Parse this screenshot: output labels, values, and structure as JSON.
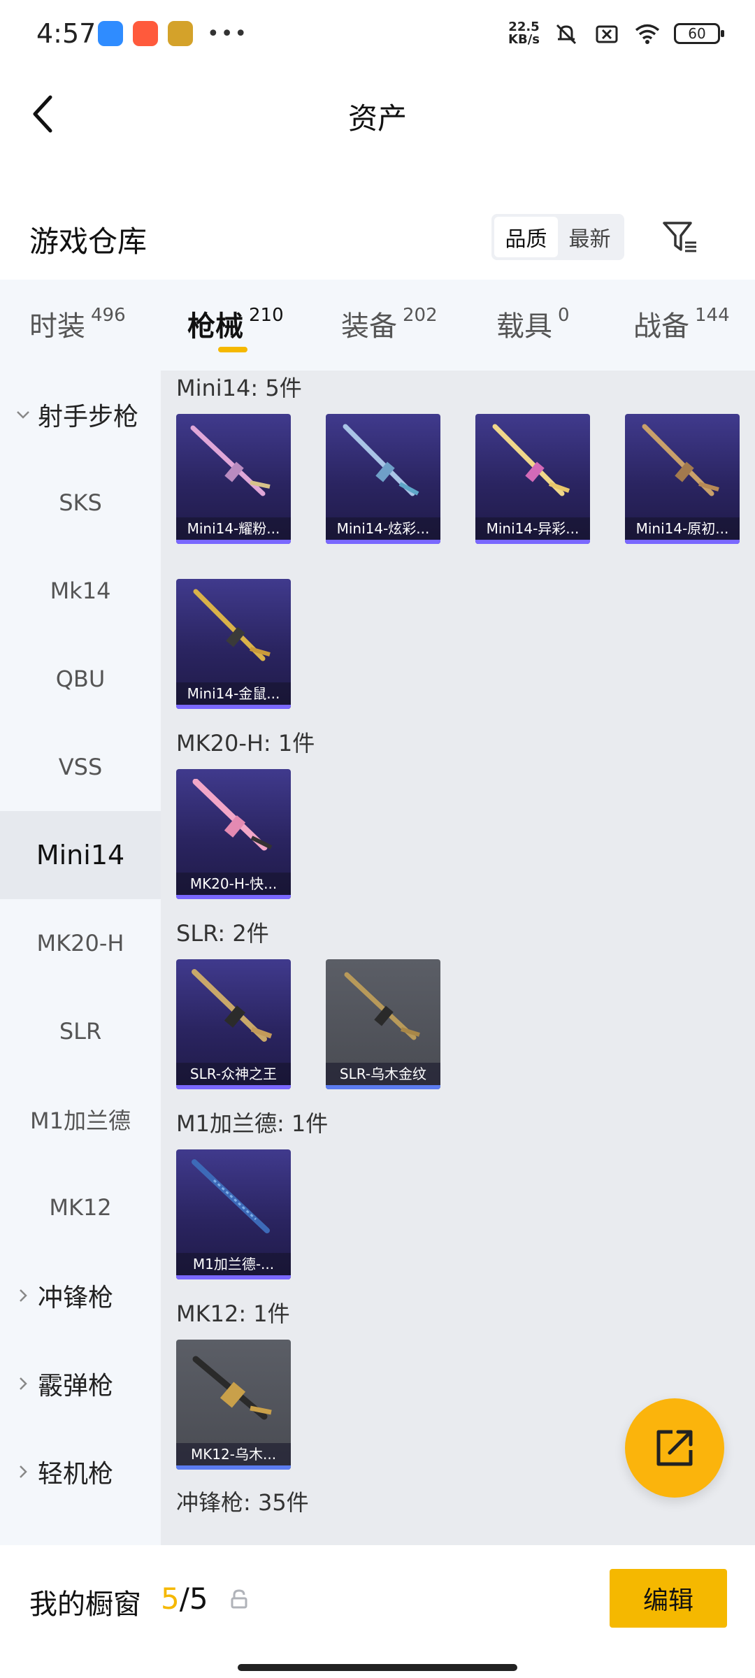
{
  "status_bar": {
    "time": "4:57",
    "net_speed_value": "22.5",
    "net_speed_unit": "KB/s",
    "battery": "60",
    "more": "•••"
  },
  "header": {
    "title": "资产",
    "back_icon": "chevron-left-icon"
  },
  "section": {
    "title": "游戏仓库",
    "sort_options": [
      "品质",
      "最新"
    ],
    "sort_selected": "品质",
    "filter_icon": "filter-icon"
  },
  "tabs": [
    {
      "label": "时装",
      "count": "496"
    },
    {
      "label": "枪械",
      "count": "210"
    },
    {
      "label": "装备",
      "count": "202"
    },
    {
      "label": "载具",
      "count": "0"
    },
    {
      "label": "战备",
      "count": "144"
    }
  ],
  "active_tab": "枪械",
  "sidebar": {
    "items": [
      {
        "label": "射手步枪",
        "type": "group",
        "expanded": true
      },
      {
        "label": "SKS",
        "type": "sub"
      },
      {
        "label": "Mk14",
        "type": "sub"
      },
      {
        "label": "QBU",
        "type": "sub"
      },
      {
        "label": "VSS",
        "type": "sub"
      },
      {
        "label": "Mini14",
        "type": "sub",
        "active": true
      },
      {
        "label": "MK20-H",
        "type": "sub"
      },
      {
        "label": "SLR",
        "type": "sub"
      },
      {
        "label": "M1加兰德",
        "type": "sub"
      },
      {
        "label": "MK12",
        "type": "sub"
      },
      {
        "label": "冲锋枪",
        "type": "group",
        "expanded": false
      },
      {
        "label": "霰弹枪",
        "type": "group",
        "expanded": false
      },
      {
        "label": "轻机枪",
        "type": "group",
        "expanded": false
      }
    ]
  },
  "groups": [
    {
      "title": "Mini14: 5件",
      "items": [
        {
          "name": "Mini14-耀粉...",
          "quality": "purple"
        },
        {
          "name": "Mini14-炫彩...",
          "quality": "purple"
        },
        {
          "name": "Mini14-异彩...",
          "quality": "purple"
        },
        {
          "name": "Mini14-原初...",
          "quality": "purple"
        },
        {
          "name": "Mini14-金鼠...",
          "quality": "purple"
        }
      ]
    },
    {
      "title": "MK20-H: 1件",
      "items": [
        {
          "name": "MK20-H-快...",
          "quality": "purple"
        }
      ]
    },
    {
      "title": "SLR: 2件",
      "items": [
        {
          "name": "SLR-众神之王",
          "quality": "purple"
        },
        {
          "name": "SLR-乌木金纹",
          "quality": "gray"
        }
      ]
    },
    {
      "title": "M1加兰德: 1件",
      "items": [
        {
          "name": "M1加兰德-...",
          "quality": "purple"
        }
      ]
    },
    {
      "title": "MK12: 1件",
      "items": [
        {
          "name": "MK12-乌木...",
          "quality": "gray"
        }
      ]
    },
    {
      "title": "冲锋枪: 35件",
      "items": []
    }
  ],
  "fab": {
    "icon": "share-external-icon"
  },
  "bottom_bar": {
    "label": "我的橱窗",
    "current": "5",
    "separator_total": "/5",
    "lock_icon": "lock-icon",
    "edit_label": "编辑"
  },
  "colors": {
    "accent": "#f5b800",
    "tab_bg": "#f4f7fb",
    "content_bg": "#e9ebef",
    "card_purple": "#2a2460",
    "card_gray": "#4f5158"
  }
}
